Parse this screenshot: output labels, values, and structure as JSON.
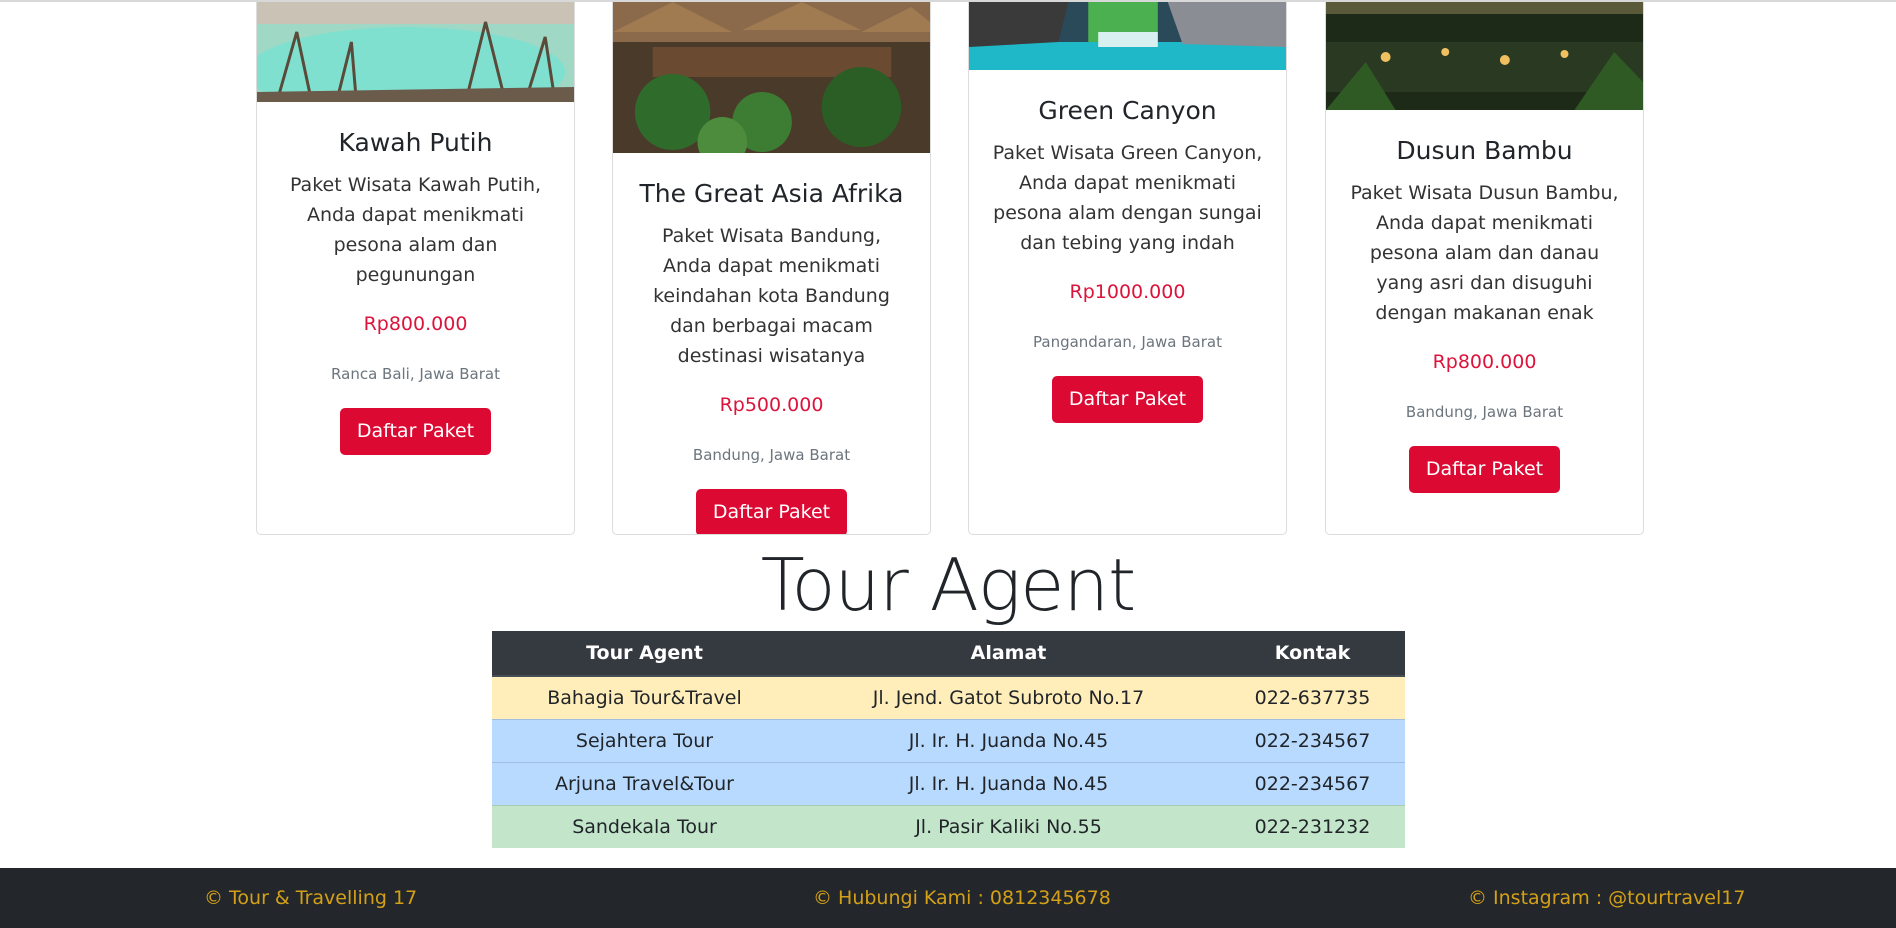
{
  "cards": [
    {
      "title": "Kawah Putih",
      "description": "Paket Wisata Kawah Putih, Anda dapat menikmati pesona alam dan pegunungan",
      "price": "Rp800.000",
      "location": "Ranca Bali, Jawa Barat",
      "button": "Daftar Paket"
    },
    {
      "title": "The Great Asia Afrika",
      "description": "Paket Wisata Bandung, Anda dapat menikmati keindahan kota Bandung dan berbagai macam destinasi wisatanya",
      "price": "Rp500.000",
      "location": "Bandung, Jawa Barat",
      "button": "Daftar Paket"
    },
    {
      "title": "Green Canyon",
      "description": "Paket Wisata Green Canyon, Anda dapat menikmati pesona alam dengan sungai dan tebing yang indah",
      "price": "Rp1000.000",
      "location": "Pangandaran, Jawa Barat",
      "button": "Daftar Paket"
    },
    {
      "title": "Dusun Bambu",
      "description": "Paket Wisata Dusun Bambu, Anda dapat menikmati pesona alam dan danau yang asri dan disuguhi dengan makanan enak",
      "price": "Rp800.000",
      "location": "Bandung, Jawa Barat",
      "button": "Daftar Paket"
    }
  ],
  "agent_section": {
    "title": "Tour Agent",
    "headers": [
      "Tour Agent",
      "Alamat",
      "Kontak"
    ],
    "rows": [
      {
        "name": "Bahagia Tour&Travel",
        "address": "Jl. Jend. Gatot Subroto No.17",
        "contact": "022-637735"
      },
      {
        "name": "Sejahtera Tour",
        "address": "Jl. Ir. H. Juanda No.45",
        "contact": "022-234567"
      },
      {
        "name": "Arjuna Travel&Tour",
        "address": "Jl. Ir. H. Juanda No.45",
        "contact": "022-234567"
      },
      {
        "name": "Sandekala Tour",
        "address": "Jl. Pasir Kaliki No.55",
        "contact": "022-231232"
      }
    ]
  },
  "footer": {
    "copyright": "© Tour & Travelling 17",
    "contact": "© Hubungi Kami : 0812345678",
    "instagram": "© Instagram : @tourtravel17"
  },
  "colors": {
    "accent": "#dc0a33",
    "price": "#dc143c",
    "footer_bg": "#23272b",
    "footer_text": "#d4a017"
  }
}
